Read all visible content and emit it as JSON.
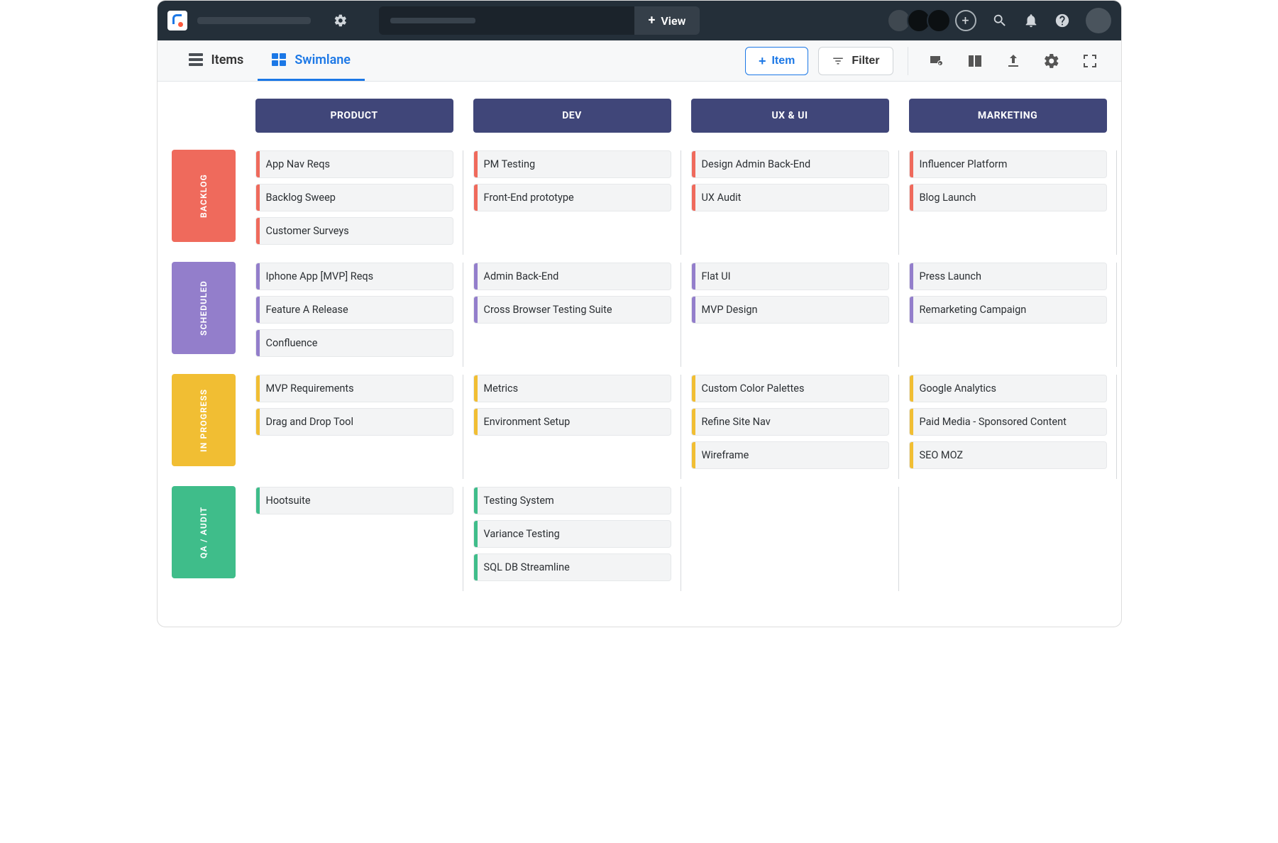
{
  "topbar": {
    "view_btn_label": "View"
  },
  "subnav": {
    "tabs": {
      "items": "Items",
      "swimlane": "Swimlane"
    },
    "add_item_label": "Item",
    "filter_label": "Filter"
  },
  "columns": [
    {
      "id": "product",
      "label": "PRODUCT"
    },
    {
      "id": "dev",
      "label": "DEV"
    },
    {
      "id": "uxui",
      "label": "UX & UI"
    },
    {
      "id": "marketing",
      "label": "MARKETING"
    }
  ],
  "rows": [
    {
      "id": "backlog",
      "label": "BACKLOG",
      "color": "#ef6a5c"
    },
    {
      "id": "scheduled",
      "label": "SCHEDULED",
      "color": "#937ecb"
    },
    {
      "id": "inprogress",
      "label": "IN PROGRESS",
      "color": "#f1be33"
    },
    {
      "id": "qaaudit",
      "label": "QA / AUDIT",
      "color": "#3fbd8a"
    }
  ],
  "cards": {
    "backlog": {
      "product": [
        "App Nav Reqs",
        "Backlog Sweep",
        "Customer Surveys"
      ],
      "dev": [
        "PM Testing",
        "Front-End prototype"
      ],
      "uxui": [
        "Design Admin Back-End",
        "UX Audit"
      ],
      "marketing": [
        "Influencer Platform",
        "Blog Launch"
      ]
    },
    "scheduled": {
      "product": [
        "Iphone App [MVP] Reqs",
        "Feature A Release",
        "Confluence"
      ],
      "dev": [
        "Admin Back-End",
        "Cross Browser Testing Suite"
      ],
      "uxui": [
        "Flat UI",
        "MVP Design"
      ],
      "marketing": [
        "Press Launch",
        "Remarketing Campaign"
      ]
    },
    "inprogress": {
      "product": [
        "MVP Requirements",
        "Drag and Drop Tool"
      ],
      "dev": [
        "Metrics",
        "Environment Setup"
      ],
      "uxui": [
        "Custom Color Palettes",
        "Refine Site Nav",
        "Wireframe"
      ],
      "marketing": [
        "Google Analytics",
        "Paid Media - Sponsored Content",
        "SEO MOZ"
      ]
    },
    "qaaudit": {
      "product": [
        "Hootsuite"
      ],
      "dev": [
        "Testing System",
        "Variance Testing",
        "SQL DB Streamline"
      ],
      "uxui": [],
      "marketing": []
    }
  }
}
